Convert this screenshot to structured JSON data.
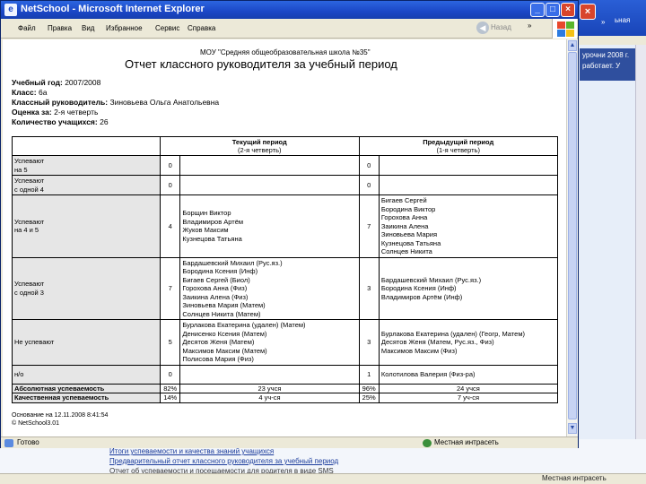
{
  "background_window": {
    "banner_line1": "урочни 2008 г.",
    "banner_line2": "работает. У",
    "tab_text": "ьная",
    "links": [
      "Итоги успеваемости и качества знаний учащихся",
      "Предварительный отчет классного руководителя за учебный период",
      "Отчет об успеваемости и посещаемости для родителя в виде SMS"
    ],
    "status_zone": "Местная интрасеть"
  },
  "window": {
    "title": "NetSchool - Microsoft Internet Explorer",
    "back_label": "Назад",
    "status_text": "Готово",
    "zone_text": "Местная интрасеть"
  },
  "menu": [
    "Файл",
    "Правка",
    "Вид",
    "Избранное",
    "Сервис",
    "Справка"
  ],
  "report": {
    "school": "МОУ \"Средняя общеобразовательная школа №35\"",
    "title": "Отчет классного руководителя за учебный период",
    "info": [
      {
        "label": "Учебный год:",
        "value": "2007/2008"
      },
      {
        "label": "Класс:",
        "value": "6а"
      },
      {
        "label": "Классный руководитель:",
        "value": "Зиновьева Ольга Анатольевна"
      },
      {
        "label": "Оценка за:",
        "value": "2-я четверть"
      },
      {
        "label": "Количество учащихся:",
        "value": "26"
      }
    ],
    "head_current_1": "Текущий период",
    "head_current_2": "(2-я четверть)",
    "head_prev_1": "Предыдущий период",
    "head_prev_2": "(1-я четверть)",
    "rows": [
      {
        "label": [
          "Успевают",
          "на 5"
        ],
        "cur_n": "0",
        "cur": [],
        "prev_n": "0",
        "prev": []
      },
      {
        "label": [
          "Успевают",
          "с одной 4"
        ],
        "cur_n": "0",
        "cur": [],
        "prev_n": "0",
        "prev": []
      },
      {
        "label": [
          "Успевают",
          "на 4 и 5"
        ],
        "cur_n": "4",
        "cur": [
          "Борщин Виктор",
          "Владимиров Артём",
          "Жуков Максим",
          "Кузнецова Татьяна"
        ],
        "prev_n": "7",
        "prev": [
          "Бигаев Сергей",
          "Бородина Виктор",
          "Горохова Анна",
          "Заикина Алена",
          "Зиновьева Мария",
          "Кузнецова Татьяна",
          "Солнцев Никита"
        ]
      },
      {
        "label": [
          "Успевают",
          "с одной 3"
        ],
        "cur_n": "7",
        "cur": [
          "Бардашевский Михаил (Рус.яз.)",
          "Бородина Ксения (Инф)",
          "Бигаев Сергей (Биол)",
          "Горохова Анна (Физ)",
          "Заикина Алена (Физ)",
          "Зиновьева Мария (Матем)",
          "Солнцев Никита (Матем)"
        ],
        "prev_n": "3",
        "prev": [
          "Бардашевский Михаил (Рус.яз.)",
          "Бородина Ксения (Инф)",
          "Владимиров Артём (Инф)"
        ]
      },
      {
        "label": [
          "Не успевают"
        ],
        "cur_n": "5",
        "cur": [
          "Бурлакова Екатерина (удален) (Матем)",
          "Денисенко Ксения (Матем)",
          "Десятов Женя (Матем)",
          "Максимов Максим (Матем)",
          "Полисова Мария (Физ)"
        ],
        "prev_n": "3",
        "prev": [
          "Бурлакова Екатерина (удален) (Геогр, Матем)",
          "Десятов Женя (Матем, Рус.яз., Физ)",
          "Максимов Максим (Физ)"
        ]
      },
      {
        "label": [
          "н/о"
        ],
        "cur_n": "0",
        "cur": [],
        "prev_n": "1",
        "prev": [
          "Колотилова Валерия (Физ-ра)"
        ]
      }
    ],
    "abs_label": "Абсолютная успеваемость",
    "abs_cur_pct": "82%",
    "abs_cur": "23 учся",
    "abs_prev_pct": "96%",
    "abs_prev": "24 учся",
    "qual_label": "Качественная успеваемость",
    "qual_cur_pct": "14%",
    "qual_cur": "4 уч-ся",
    "qual_prev_pct": "25%",
    "qual_prev": "7 уч-ся",
    "footer_created": "Основание на 12.11.2008 8:41:54",
    "footer_version": "© NetSchool3.01"
  }
}
